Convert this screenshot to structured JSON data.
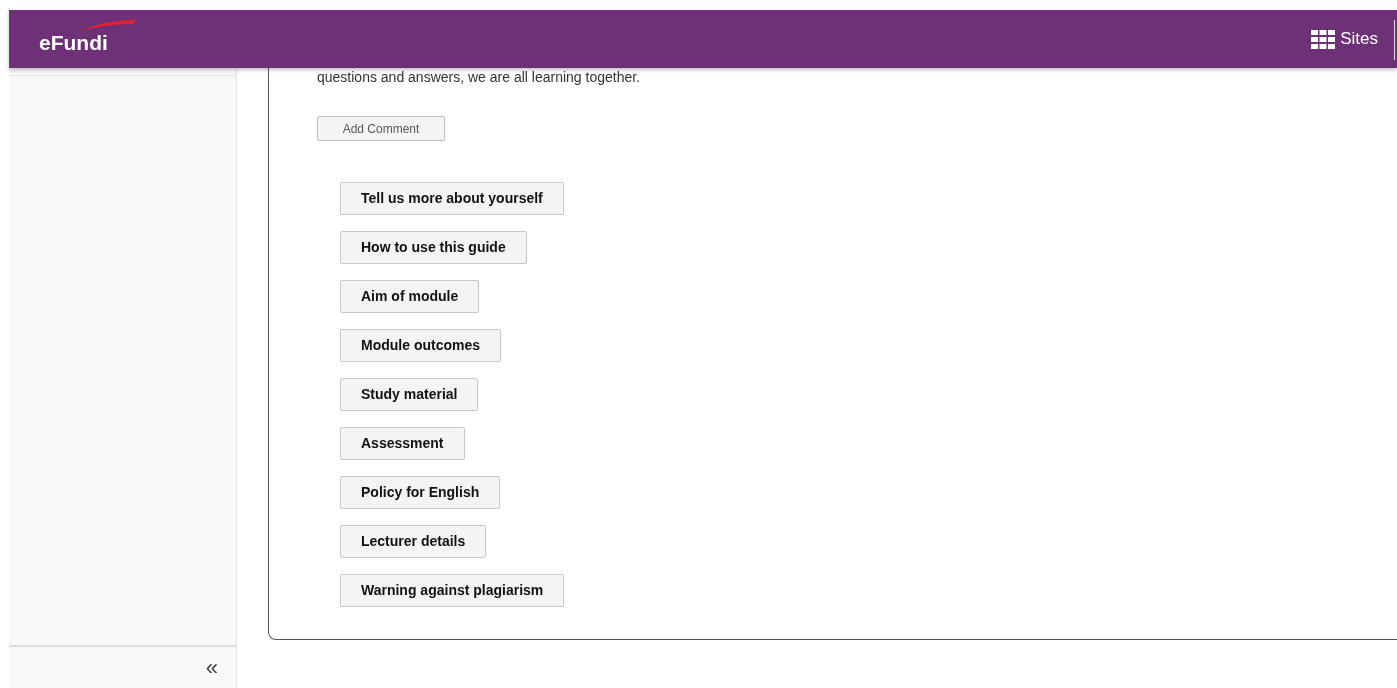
{
  "header": {
    "logo": "eFundi",
    "sites_label": "Sites"
  },
  "sidebar": {
    "collapse_symbol": "«"
  },
  "content": {
    "intro_text": "questions and answers, we are all learning together.",
    "comment_button": "Add Comment",
    "links": [
      "Tell us more about yourself",
      "How to use this guide",
      "Aim of module",
      "Module outcomes",
      "Study material",
      "Assessment",
      "Policy for English",
      "Lecturer details",
      "Warning against plagiarism"
    ]
  }
}
